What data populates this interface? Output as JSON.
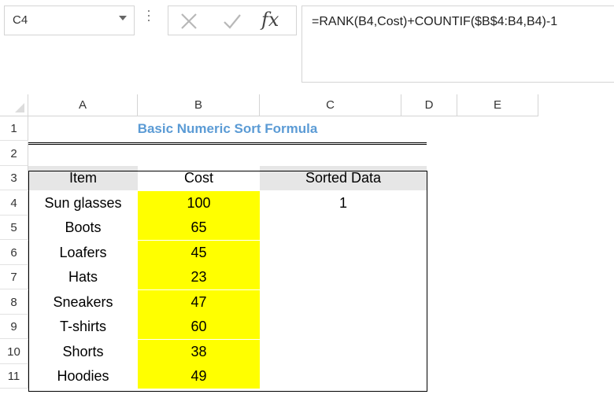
{
  "formula_bar": {
    "name_box": "C4",
    "formula": "=RANK(B4,Cost)+COUNTIF($B$4:B4,B4)-1",
    "fx_label": "fx"
  },
  "columns": [
    "A",
    "B",
    "C",
    "D",
    "E"
  ],
  "rows": [
    "1",
    "2",
    "3",
    "4",
    "5",
    "6",
    "7",
    "8",
    "9",
    "10",
    "11"
  ],
  "sheet": {
    "title": "Basic Numeric Sort Formula",
    "headers": {
      "item": "Item",
      "cost": "Cost",
      "sorted": "Sorted Data"
    },
    "data": [
      {
        "item": "Sun glasses",
        "cost": "100",
        "sorted": "1"
      },
      {
        "item": "Boots",
        "cost": "65",
        "sorted": ""
      },
      {
        "item": "Loafers",
        "cost": "45",
        "sorted": ""
      },
      {
        "item": "Hats",
        "cost": "23",
        "sorted": ""
      },
      {
        "item": "Sneakers",
        "cost": "47",
        "sorted": ""
      },
      {
        "item": "T-shirts",
        "cost": "60",
        "sorted": ""
      },
      {
        "item": "Shorts",
        "cost": "38",
        "sorted": ""
      },
      {
        "item": "Hoodies",
        "cost": "49",
        "sorted": ""
      }
    ]
  },
  "colors": {
    "title": "#5b9bd5",
    "highlight": "#ffff00",
    "header_fill": "#e6e6e6"
  }
}
